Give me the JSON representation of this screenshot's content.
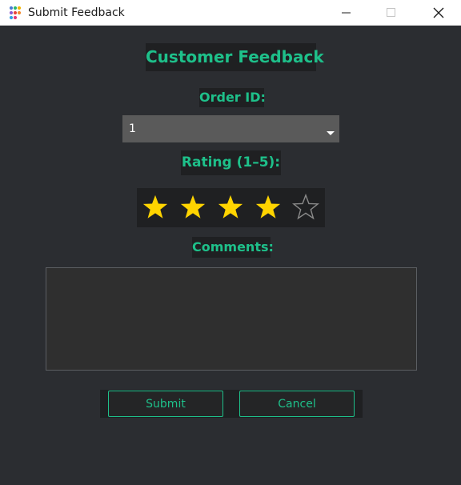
{
  "window": {
    "title": "Submit Feedback",
    "icons": {
      "app": "app-dots-icon",
      "minimize": "minimize-icon",
      "maximize": "maximize-icon",
      "close": "close-icon"
    }
  },
  "form": {
    "heading": "Customer Feedback",
    "order_label": "Order ID:",
    "order_selected": "1",
    "rating_label": "Rating (1–5):",
    "rating": {
      "value": 4,
      "max": 5,
      "filled_color": "#ffd400",
      "empty_color": "#8a8a8a"
    },
    "comments_label": "Comments:",
    "comments_value": "",
    "submit_label": "Submit",
    "cancel_label": "Cancel"
  },
  "colors": {
    "accent": "#1ec08a",
    "background": "#2b2d31",
    "label_background": "#1f2022"
  }
}
